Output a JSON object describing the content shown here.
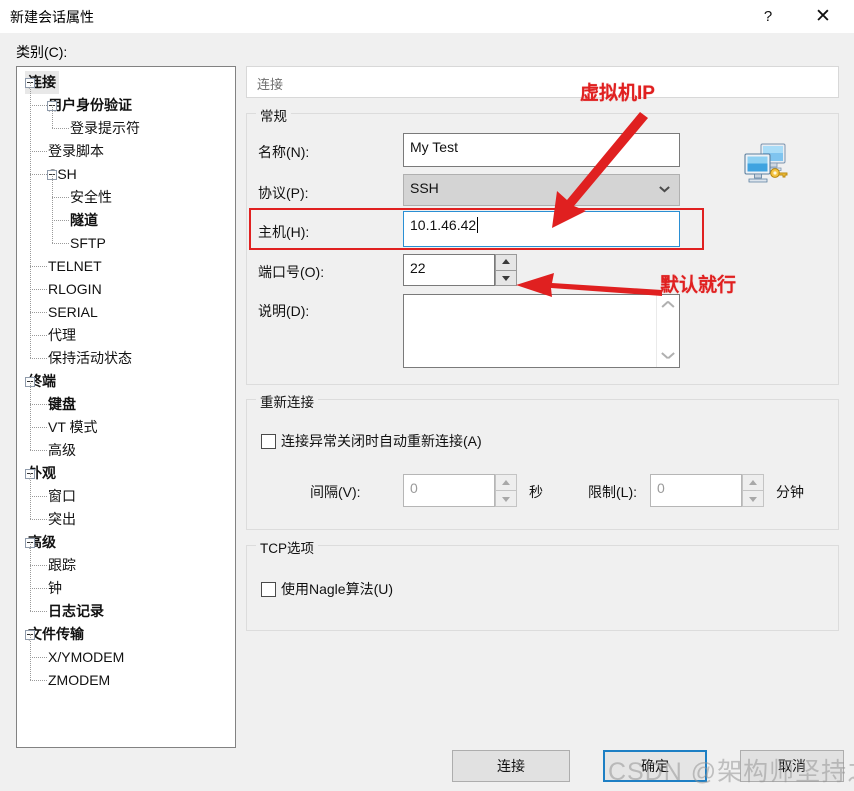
{
  "window": {
    "title": "新建会话属性",
    "help_label": "?",
    "close_label": "✕"
  },
  "category": {
    "label": "类别(C):",
    "tree": [
      {
        "label": "连接",
        "level": 0,
        "expander": true,
        "bold": true,
        "selected": true
      },
      {
        "label": "用户身份验证",
        "level": 1,
        "expander": true,
        "bold": true,
        "selected": false
      },
      {
        "label": "登录提示符",
        "level": 2,
        "expander": false,
        "bold": false,
        "selected": false
      },
      {
        "label": "登录脚本",
        "level": 1,
        "expander": false,
        "bold": false,
        "selected": false
      },
      {
        "label": "SSH",
        "level": 1,
        "expander": true,
        "bold": false,
        "selected": false
      },
      {
        "label": "安全性",
        "level": 2,
        "expander": false,
        "bold": false,
        "selected": false
      },
      {
        "label": "隧道",
        "level": 2,
        "expander": false,
        "bold": true,
        "selected": false
      },
      {
        "label": "SFTP",
        "level": 2,
        "expander": false,
        "bold": false,
        "selected": false
      },
      {
        "label": "TELNET",
        "level": 1,
        "expander": false,
        "bold": false,
        "selected": false
      },
      {
        "label": "RLOGIN",
        "level": 1,
        "expander": false,
        "bold": false,
        "selected": false
      },
      {
        "label": "SERIAL",
        "level": 1,
        "expander": false,
        "bold": false,
        "selected": false
      },
      {
        "label": "代理",
        "level": 1,
        "expander": false,
        "bold": false,
        "selected": false
      },
      {
        "label": "保持活动状态",
        "level": 1,
        "expander": false,
        "bold": false,
        "selected": false
      },
      {
        "label": "终端",
        "level": 0,
        "expander": true,
        "bold": true,
        "selected": false
      },
      {
        "label": "键盘",
        "level": 1,
        "expander": false,
        "bold": true,
        "selected": false
      },
      {
        "label": "VT 模式",
        "level": 1,
        "expander": false,
        "bold": false,
        "selected": false
      },
      {
        "label": "高级",
        "level": 1,
        "expander": false,
        "bold": false,
        "selected": false
      },
      {
        "label": "外观",
        "level": 0,
        "expander": true,
        "bold": true,
        "selected": false
      },
      {
        "label": "窗口",
        "level": 1,
        "expander": false,
        "bold": false,
        "selected": false
      },
      {
        "label": "突出",
        "level": 1,
        "expander": false,
        "bold": false,
        "selected": false
      },
      {
        "label": "高级",
        "level": 0,
        "expander": true,
        "bold": true,
        "selected": false
      },
      {
        "label": "跟踪",
        "level": 1,
        "expander": false,
        "bold": false,
        "selected": false
      },
      {
        "label": "钟",
        "level": 1,
        "expander": false,
        "bold": false,
        "selected": false
      },
      {
        "label": "日志记录",
        "level": 1,
        "expander": false,
        "bold": true,
        "selected": false
      },
      {
        "label": "文件传输",
        "level": 0,
        "expander": true,
        "bold": true,
        "selected": false
      },
      {
        "label": "X/YMODEM",
        "level": 1,
        "expander": false,
        "bold": false,
        "selected": false
      },
      {
        "label": "ZMODEM",
        "level": 1,
        "expander": false,
        "bold": false,
        "selected": false
      }
    ]
  },
  "page": {
    "header": "连接"
  },
  "general": {
    "legend": "常规",
    "name_label": "名称(N):",
    "name_value": "My Test",
    "protocol_label": "协议(P):",
    "protocol_value": "SSH",
    "host_label": "主机(H):",
    "host_value": "10.1.46.42",
    "port_label": "端口号(O):",
    "port_value": "22",
    "desc_label": "说明(D):",
    "desc_value": ""
  },
  "reconnect": {
    "legend": "重新连接",
    "auto_label": "连接异常关闭时自动重新连接(A)",
    "auto_checked": false,
    "interval_label": "间隔(V):",
    "interval_value": "0",
    "interval_unit": "秒",
    "limit_label": "限制(L):",
    "limit_value": "0",
    "limit_unit": "分钟"
  },
  "tcp": {
    "legend": "TCP选项",
    "nagle_label": "使用Nagle算法(U)",
    "nagle_checked": false
  },
  "buttons": {
    "connect": "连接",
    "ok": "确定",
    "cancel": "取消"
  },
  "annotations": {
    "ip_note": "虚拟机IP",
    "default_note": "默认就行"
  },
  "watermark": {
    "text": "CSDN @架构师坚持之路"
  },
  "colors": {
    "annotation_red": "#e02020",
    "focus_blue": "#2a8fd4",
    "default_button_blue": "#1d7fc4",
    "dialog_bg": "#f0f0f0"
  }
}
